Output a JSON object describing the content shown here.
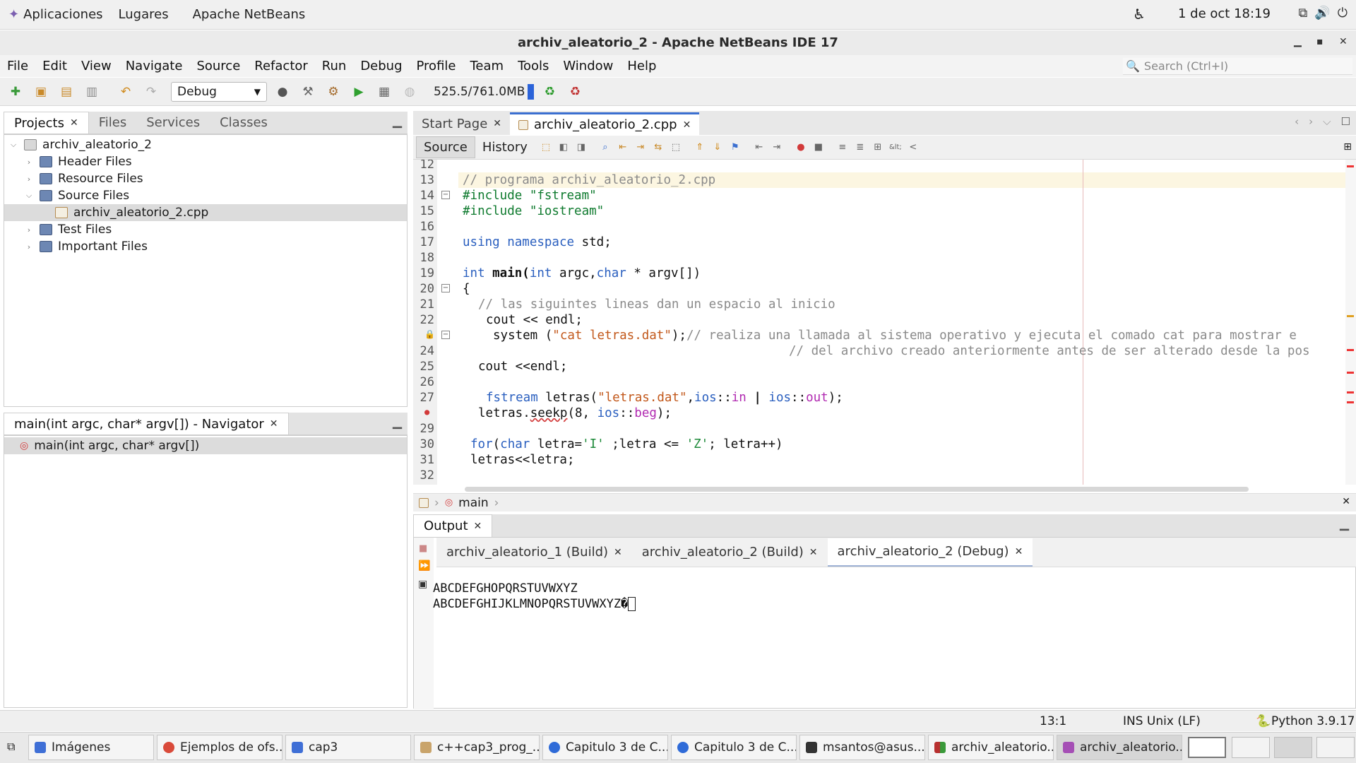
{
  "topbar": {
    "apps_label": "Aplicaciones",
    "places_label": "Lugares",
    "app_name": "Apache NetBeans",
    "clock": "1 de oct  18:19"
  },
  "window": {
    "title": "archiv_aleatorio_2 - Apache NetBeans IDE 17"
  },
  "menu": [
    "File",
    "Edit",
    "View",
    "Navigate",
    "Source",
    "Refactor",
    "Run",
    "Debug",
    "Profile",
    "Team",
    "Tools",
    "Window",
    "Help"
  ],
  "search": {
    "placeholder": "Search (Ctrl+I)"
  },
  "toolbar": {
    "config": "Debug",
    "memory": "525.5/761.0MB"
  },
  "projects_panel": {
    "tabs": [
      "Projects",
      "Files",
      "Services",
      "Classes"
    ],
    "tree": [
      {
        "label": "archiv_aleatorio_2",
        "depth": 0,
        "icon": "project-icon",
        "expanded": true
      },
      {
        "label": "Header Files",
        "depth": 1,
        "icon": "folder-icon",
        "expanded": false
      },
      {
        "label": "Resource Files",
        "depth": 1,
        "icon": "folder-icon",
        "expanded": false
      },
      {
        "label": "Source Files",
        "depth": 1,
        "icon": "folder-icon",
        "expanded": true
      },
      {
        "label": "archiv_aleatorio_2.cpp",
        "depth": 2,
        "icon": "cpp-file-icon",
        "selected": true
      },
      {
        "label": "Test Files",
        "depth": 1,
        "icon": "folder-icon",
        "expanded": false
      },
      {
        "label": "Important Files",
        "depth": 1,
        "icon": "folder-icon",
        "expanded": false
      }
    ]
  },
  "navigator": {
    "title": "main(int argc, char* argv[]) - Navigator",
    "item": "main(int argc, char* argv[])"
  },
  "editor": {
    "tabs": [
      "Start Page",
      "archiv_aleatorio_2.cpp"
    ],
    "subtabs": [
      "Source",
      "History"
    ],
    "line_numbers": [
      "12",
      "13",
      "14",
      "15",
      "16",
      "17",
      "18",
      "19",
      "20",
      "21",
      "22",
      "23",
      "24",
      "25",
      "26",
      "27",
      "28",
      "29",
      "30",
      "31",
      "32"
    ],
    "lines": {
      "l13": "// programa archiv_aleatorio_2.cpp",
      "l14": "#include \"fstream\"",
      "l15": "#include \"iostream\"",
      "l17a": "using namespace",
      "l17b": " std;",
      "l19a": "int",
      "l19b": " main(",
      "l19c": "int",
      "l19d": " argc,",
      "l19e": "char",
      "l19f": " * argv[])",
      "l20": "{",
      "l21": "// las siguintes lineas dan un espacio al inicio",
      "l22": "cout << endl;",
      "l23a": "system (",
      "l23b": "\"cat letras.dat\"",
      "l23c": ");",
      "l23d": "// realiza una llamada al sistema operativo y ejecuta el comado cat para mostrar e",
      "l24": "// del archivo creado anteriormente antes de ser alterado desde la pos",
      "l25": "cout <<endl;",
      "l27a": "fstream",
      "l27b": " letras(",
      "l27c": "\"letras.dat\"",
      "l27d": ",",
      "l27e": "ios",
      "l27f": "::",
      "l27g": "in",
      "l27h": " | ",
      "l27i": "ios",
      "l27j": "::",
      "l27k": "out",
      "l27l": ");",
      "l28a": "letras.",
      "l28b": "seekp",
      "l28c": "(8, ",
      "l28d": "ios",
      "l28e": "::",
      "l28f": "beg",
      "l28g": ");",
      "l30a": "for",
      "l30b": "(",
      "l30c": "char",
      "l30d": " letra=",
      "l30e": "'I'",
      "l30f": " ;letra <= ",
      "l30g": "'Z'",
      "l30h": "; letra++)",
      "l31": "letras<<letra;"
    },
    "breadcrumb": "main"
  },
  "output": {
    "title": "Output",
    "tabs": [
      "archiv_aleatorio_1 (Build)",
      "archiv_aleatorio_2 (Build)",
      "archiv_aleatorio_2 (Debug)"
    ],
    "console": [
      "ABCDEFGHOPQRSTUVWXYZ",
      "ABCDEFGHIJKLMNOPQRSTUVWXYZ�"
    ]
  },
  "status": {
    "position": "13:1",
    "mode": "INS Unix (LF)",
    "platform": "Python 3.9.17"
  },
  "taskbar": [
    {
      "label": "Imágenes",
      "color": "#3f6fd6"
    },
    {
      "label": "Ejemplos de ofs...",
      "color": "#d94a3a"
    },
    {
      "label": "cap3",
      "color": "#3f6fd6"
    },
    {
      "label": "c++cap3_prog_...",
      "color": "#c9a46b"
    },
    {
      "label": "Capitulo 3 de C...",
      "color": "#2f6bd8"
    },
    {
      "label": "Capitulo 3 de C...",
      "color": "#2f6bd8"
    },
    {
      "label": "msantos@asus...",
      "color": "#333333"
    },
    {
      "label": "archiv_aleatorio...",
      "color": "#b83030"
    },
    {
      "label": "archiv_aleatorio...",
      "color": "#a54fb5"
    }
  ],
  "colors": {
    "accent": "#3b6fd0",
    "keyword": "#2a5fbf",
    "string": "#c2581b",
    "comment": "#8a8a8a"
  }
}
